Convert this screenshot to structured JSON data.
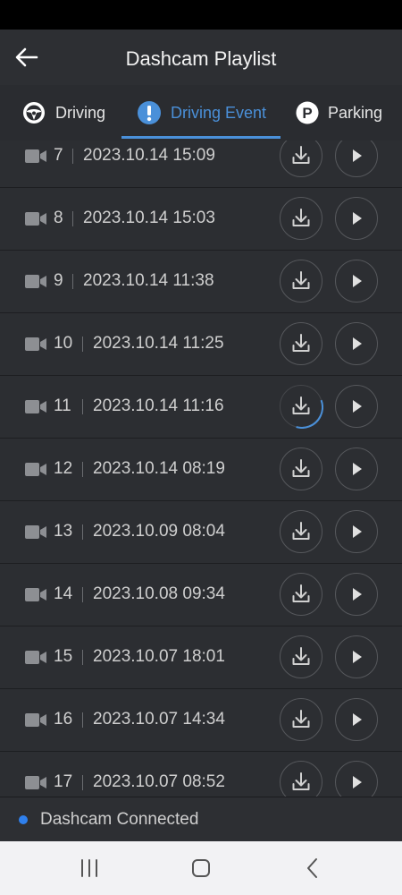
{
  "header": {
    "title": "Dashcam Playlist",
    "back_icon": "arrow-left-icon"
  },
  "tabs": [
    {
      "label": "Driving",
      "icon": "steering-wheel-icon",
      "active": false
    },
    {
      "label": "Driving Event",
      "icon": "exclamation-icon",
      "active": true
    },
    {
      "label": "Parking",
      "icon": "parking-icon",
      "active": false
    }
  ],
  "colors": {
    "accent": "#4a90d9",
    "background": "#2a2c30",
    "status_dot": "#2f80ed"
  },
  "list": {
    "items": [
      {
        "index": "7",
        "date": "2023.10.14 15:09"
      },
      {
        "index": "8",
        "date": "2023.10.14 15:03"
      },
      {
        "index": "9",
        "date": "2023.10.14 11:38"
      },
      {
        "index": "10",
        "date": "2023.10.14 11:25"
      },
      {
        "index": "11",
        "date": "2023.10.14 11:16",
        "download_progress": 0.35
      },
      {
        "index": "12",
        "date": "2023.10.14 08:19"
      },
      {
        "index": "13",
        "date": "2023.10.09 08:04"
      },
      {
        "index": "14",
        "date": "2023.10.08 09:34"
      },
      {
        "index": "15",
        "date": "2023.10.07 18:01"
      },
      {
        "index": "16",
        "date": "2023.10.07 14:34"
      },
      {
        "index": "17",
        "date": "2023.10.07 08:52"
      }
    ]
  },
  "footer": {
    "status_text": "Dashcam Connected"
  },
  "navbar": {
    "icons": [
      "recent-apps-icon",
      "home-icon",
      "back-icon"
    ]
  }
}
